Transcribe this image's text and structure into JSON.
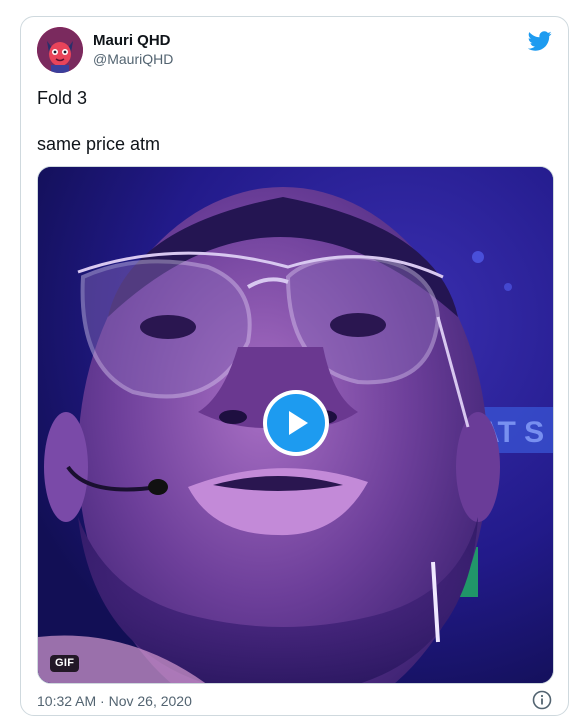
{
  "tweet": {
    "display_name": "Mauri QHD",
    "handle": "@MauriQHD",
    "text_line1": "Fold 3",
    "text_line2": "same price atm",
    "media": {
      "badge": "GIF",
      "play_icon": "play-icon"
    },
    "timestamp": "10:32 AM · Nov 26, 2020"
  },
  "icons": {
    "brand": "twitter-bird-icon",
    "info": "info-icon"
  },
  "colors": {
    "twitter_blue": "#1d9bf0",
    "text_primary": "#0f1419",
    "text_secondary": "#536471",
    "border": "#cfd9de"
  }
}
